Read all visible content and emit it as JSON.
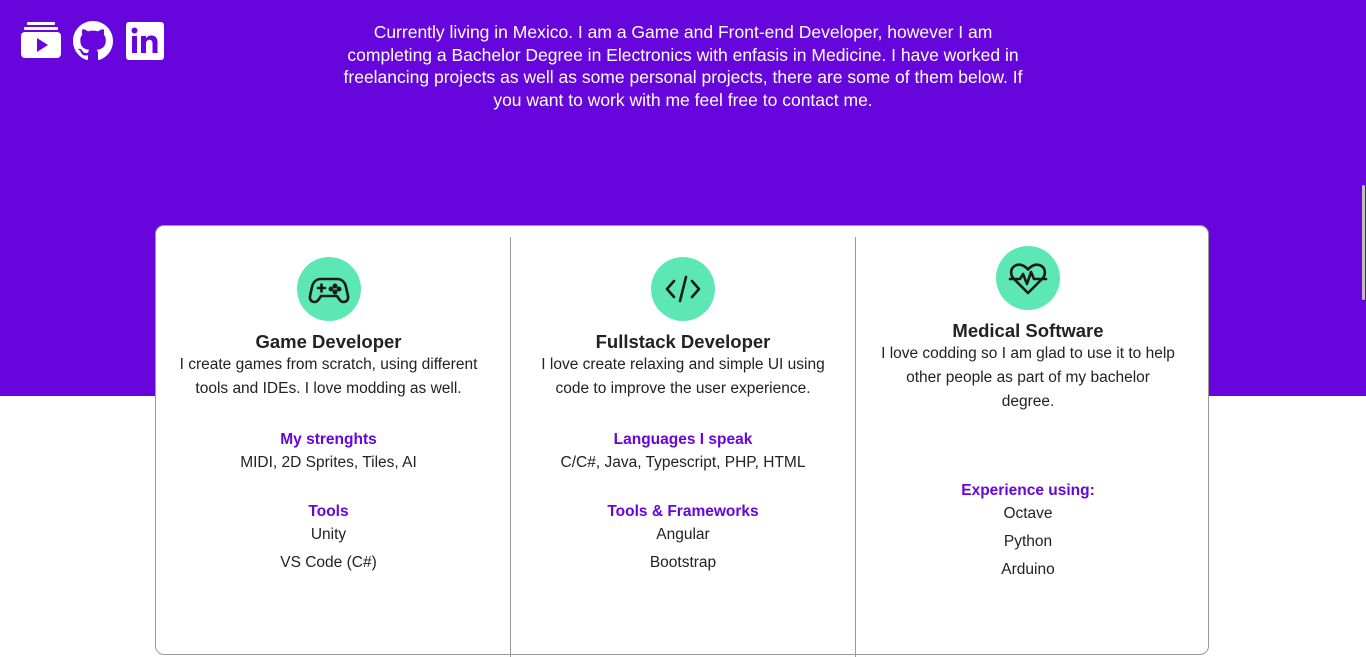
{
  "colors": {
    "brand": "#6605dc",
    "accent": "#5de7b5"
  },
  "social": [
    {
      "icon": "youtube-icon"
    },
    {
      "icon": "github-icon"
    },
    {
      "icon": "linkedin-icon"
    }
  ],
  "intro": "Currently living in Mexico. I am a Game and Front-end Developer, however I am completing a Bachelor Degree in Electronics with enfasis in Medicine. I have worked in freelancing projects as well as some personal projects, there are some of them below. If you want to work with me feel free to contact me.",
  "columns": [
    {
      "icon": "gamepad-icon",
      "title": "Game Developer",
      "description": "I create games from scratch, using different tools and IDEs. I love modding as well.",
      "section1_title": "My strenghts",
      "section1_items": [
        "MIDI, 2D Sprites, Tiles, AI"
      ],
      "section2_title": "Tools",
      "section2_items": [
        "Unity",
        "VS Code (C#)"
      ]
    },
    {
      "icon": "code-icon",
      "title": "Fullstack Developer",
      "description": "I love create relaxing and simple UI using code to improve the user experience.",
      "section1_title": "Languages I speak",
      "section1_items": [
        "C/C#, Java, Typescript, PHP, HTML"
      ],
      "section2_title": "Tools & Frameworks",
      "section2_items": [
        "Angular",
        "Bootstrap"
      ]
    },
    {
      "icon": "heart-pulse-icon",
      "title": "Medical Software",
      "description": "I love codding so I am glad to use it to help other people as part of my bachelor degree.",
      "section1_title": "Experience using:",
      "section1_items": [
        "Octave",
        "Python",
        "Arduino"
      ]
    }
  ]
}
